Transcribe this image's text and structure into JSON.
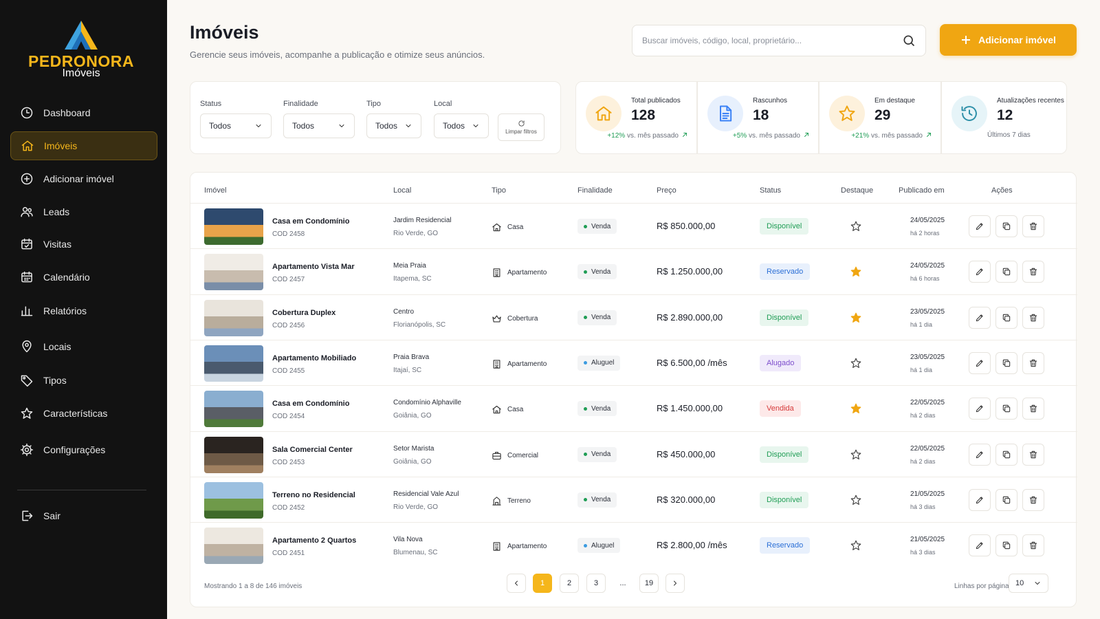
{
  "brand": {
    "name": "PEDRONORA",
    "sub": "Imóveis",
    "accent": "#f5b61b"
  },
  "nav": [
    {
      "label": "Dashboard",
      "icon": "clock-icon",
      "active": false
    },
    {
      "label": "Imóveis",
      "icon": "home-icon",
      "active": true
    },
    {
      "label": "Adicionar imóvel",
      "icon": "plus-circle-icon",
      "active": false
    },
    {
      "label": "Leads",
      "icon": "users-icon",
      "active": false
    },
    {
      "label": "Visitas",
      "icon": "calendar-check-icon",
      "active": false
    },
    {
      "label": "Calendário",
      "icon": "calendar-icon",
      "active": false
    },
    {
      "label": "Relatórios",
      "icon": "bar-chart-icon",
      "active": false
    },
    {
      "label": "Locais",
      "icon": "map-pin-icon",
      "active": false
    },
    {
      "label": "Tipos",
      "icon": "tag-icon",
      "active": false
    },
    {
      "label": "Características",
      "icon": "star-icon",
      "active": false
    },
    {
      "label": "Configurações",
      "icon": "gear-icon",
      "active": false
    }
  ],
  "logout": {
    "label": "Sair",
    "icon": "logout-icon"
  },
  "header": {
    "title": "Imóveis",
    "subtitle": "Gerencie seus imóveis, acompanhe a publicação e otimize seus anúncios.",
    "search_placeholder": "Buscar imóveis, código, local, proprietário...",
    "add_label": "Adicionar imóvel"
  },
  "filters": {
    "items": [
      {
        "label": "Status",
        "value": "Todos"
      },
      {
        "label": "Finalidade",
        "value": "Todos"
      },
      {
        "label": "Tipo",
        "value": "Todos"
      },
      {
        "label": "Local",
        "value": "Todos"
      }
    ],
    "clear_label": "Limpar filtros"
  },
  "stats": [
    {
      "label": "Total publicados",
      "value": "128",
      "delta": "+12%",
      "delta_text": "vs. mês passado",
      "icon": "home-icon",
      "color": "#f0a612",
      "bg": "#fdf1dc"
    },
    {
      "label": "Rascunhos",
      "value": "18",
      "delta": "+5%",
      "delta_text": "vs. mês passado",
      "icon": "document-icon",
      "color": "#3b82f6",
      "bg": "#e7f0fd"
    },
    {
      "label": "Em destaque",
      "value": "29",
      "delta": "+21%",
      "delta_text": "vs. mês passado",
      "icon": "star-icon",
      "color": "#f0a612",
      "bg": "#fdf1dc"
    },
    {
      "label": "Atualizações recentes",
      "value": "12",
      "delta": "",
      "delta_text": "Últimos 7 dias",
      "icon": "history-icon",
      "color": "#2d8fa8",
      "bg": "#e6f4f8"
    }
  ],
  "table": {
    "headers": [
      "Imóvel",
      "Local",
      "Tipo",
      "Finalidade",
      "Preço",
      "Status",
      "Destaque",
      "Publicado em",
      "Ações"
    ],
    "rows": [
      {
        "name": "Casa em Condomínio",
        "code": "COD 2458",
        "loc1": "Jardim Residencial",
        "loc2": "Rio Verde, GO",
        "tipo": "Casa",
        "tipo_icon": "house-icon",
        "finalidade": "Venda",
        "preco": "R$ 850.000,00",
        "status": "Disponível",
        "destaque": false,
        "pub1": "24/05/2025",
        "pub2": "há 2 horas"
      },
      {
        "name": "Apartamento Vista Mar",
        "code": "COD 2457",
        "loc1": "Meia Praia",
        "loc2": "Itapema, SC",
        "tipo": "Apartamento",
        "tipo_icon": "building-icon",
        "finalidade": "Venda",
        "preco": "R$ 1.250.000,00",
        "status": "Reservado",
        "destaque": true,
        "pub1": "24/05/2025",
        "pub2": "há 6 horas"
      },
      {
        "name": "Cobertura Duplex",
        "code": "COD 2456",
        "loc1": "Centro",
        "loc2": "Florianópolis, SC",
        "tipo": "Cobertura",
        "tipo_icon": "crown-icon",
        "finalidade": "Venda",
        "preco": "R$ 2.890.000,00",
        "status": "Disponível",
        "destaque": true,
        "pub1": "23/05/2025",
        "pub2": "há 1 dia"
      },
      {
        "name": "Apartamento Mobiliado",
        "code": "COD 2455",
        "loc1": "Praia Brava",
        "loc2": "Itajaí, SC",
        "tipo": "Apartamento",
        "tipo_icon": "building-icon",
        "finalidade": "Aluguel",
        "preco": "R$ 6.500,00 /mês",
        "status": "Alugado",
        "destaque": false,
        "pub1": "23/05/2025",
        "pub2": "há 1 dia"
      },
      {
        "name": "Casa em Condomínio",
        "code": "COD 2454",
        "loc1": "Condomínio Alphaville",
        "loc2": "Goiânia, GO",
        "tipo": "Casa",
        "tipo_icon": "house-icon",
        "finalidade": "Venda",
        "preco": "R$ 1.450.000,00",
        "status": "Vendida",
        "destaque": true,
        "pub1": "22/05/2025",
        "pub2": "há 2 dias"
      },
      {
        "name": "Sala Comercial Center",
        "code": "COD 2453",
        "loc1": "Setor Marista",
        "loc2": "Goiânia, GO",
        "tipo": "Comercial",
        "tipo_icon": "briefcase-icon",
        "finalidade": "Venda",
        "preco": "R$ 450.000,00",
        "status": "Disponível",
        "destaque": false,
        "pub1": "22/05/2025",
        "pub2": "há 2 dias"
      },
      {
        "name": "Terreno no Residencial",
        "code": "COD 2452",
        "loc1": "Residencial Vale Azul",
        "loc2": "Rio Verde, GO",
        "tipo": "Terreno",
        "tipo_icon": "land-icon",
        "finalidade": "Venda",
        "preco": "R$ 320.000,00",
        "status": "Disponível",
        "destaque": false,
        "pub1": "21/05/2025",
        "pub2": "há 3 dias"
      },
      {
        "name": "Apartamento 2 Quartos",
        "code": "COD 2451",
        "loc1": "Vila Nova",
        "loc2": "Blumenau, SC",
        "tipo": "Apartamento",
        "tipo_icon": "building-icon",
        "finalidade": "Aluguel",
        "preco": "R$ 2.800,00 /mês",
        "status": "Reservado",
        "destaque": false,
        "pub1": "21/05/2025",
        "pub2": "há 3 dias"
      }
    ]
  },
  "status_colors": {
    "Disponível": {
      "fg": "#1f9d55",
      "bg": "#e8f6ee"
    },
    "Reservado": {
      "fg": "#2b6fd6",
      "bg": "#e8f0fc"
    },
    "Alugado": {
      "fg": "#7c4dcc",
      "bg": "#f0eafb"
    },
    "Vendida": {
      "fg": "#d63a3a",
      "bg": "#fde9e9"
    }
  },
  "finalidade_colors": {
    "Venda": "#1f9d55",
    "Aluguel": "#3b9be0"
  },
  "footer": {
    "showing": "Mostrando 1 a 8 de 146 imóveis",
    "pages": [
      "1",
      "2",
      "3",
      "...",
      "19"
    ],
    "current_page": "1",
    "rows_per_page_label": "Linhas por página",
    "rows_per_page": "10"
  }
}
